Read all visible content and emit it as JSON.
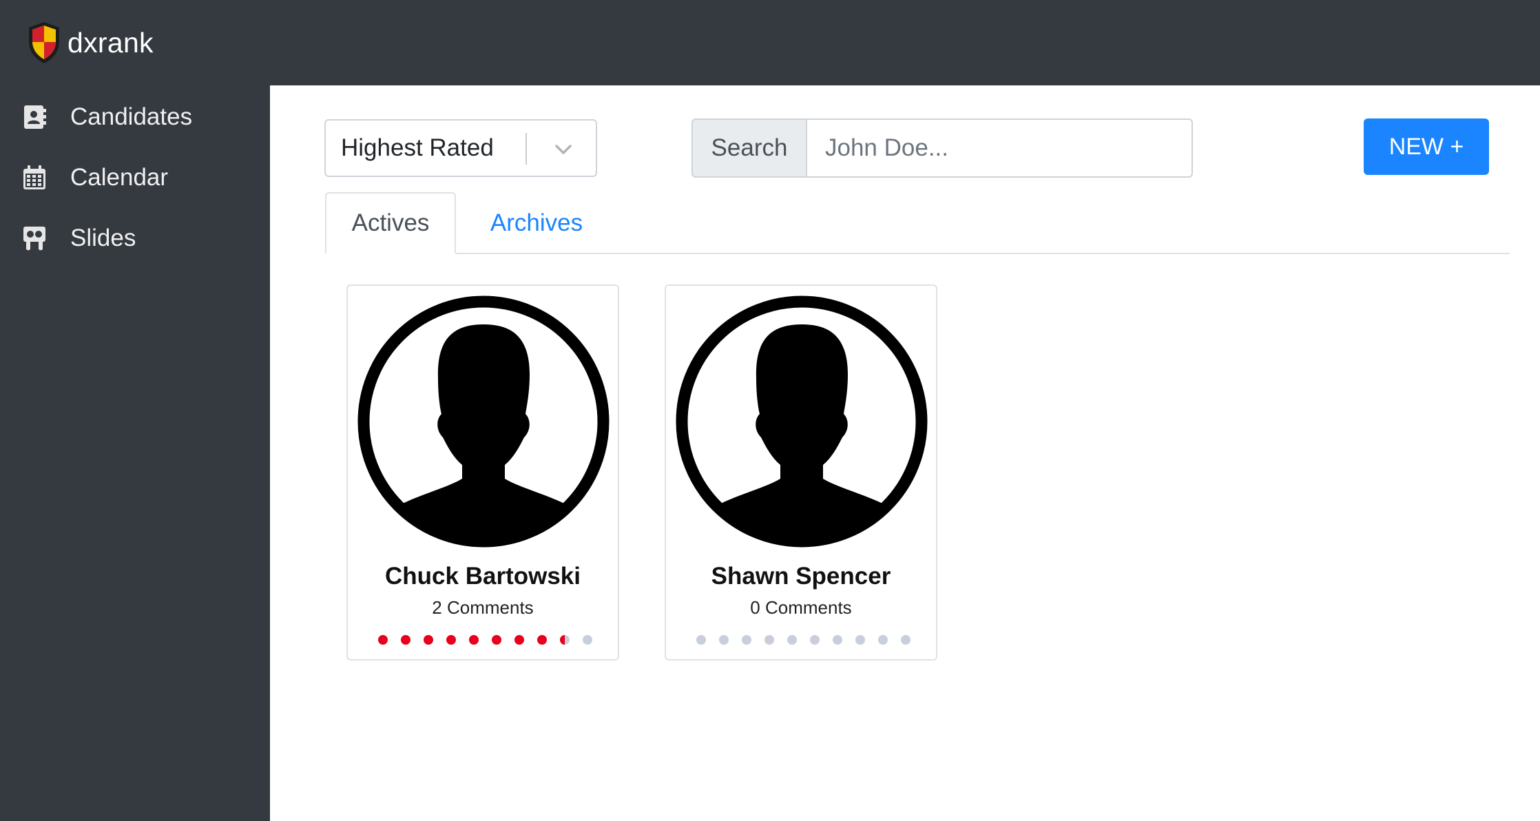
{
  "app": {
    "title": "dxrank"
  },
  "sidebar": {
    "items": [
      {
        "label": "Candidates",
        "icon": "address-book-icon"
      },
      {
        "label": "Calendar",
        "icon": "calendar-icon"
      },
      {
        "label": "Slides",
        "icon": "slideshare-icon"
      }
    ]
  },
  "toolbar": {
    "sort_selected": "Highest Rated",
    "search_label": "Search",
    "search_placeholder": "John Doe...",
    "search_value": "",
    "new_label": "NEW +"
  },
  "tabs": [
    {
      "label": "Actives",
      "active": true
    },
    {
      "label": "Archives",
      "active": false
    }
  ],
  "candidates": [
    {
      "name": "Chuck Bartowski",
      "comments": "2 Comments",
      "rating": 8.5,
      "rating_max": 10
    },
    {
      "name": "Shawn Spencer",
      "comments": "0 Comments",
      "rating": 0,
      "rating_max": 10
    }
  ],
  "colors": {
    "topbar": "#343a40",
    "accent": "#1a85ff",
    "rating_on": "#e8001c",
    "rating_off": "#c8cedb"
  }
}
